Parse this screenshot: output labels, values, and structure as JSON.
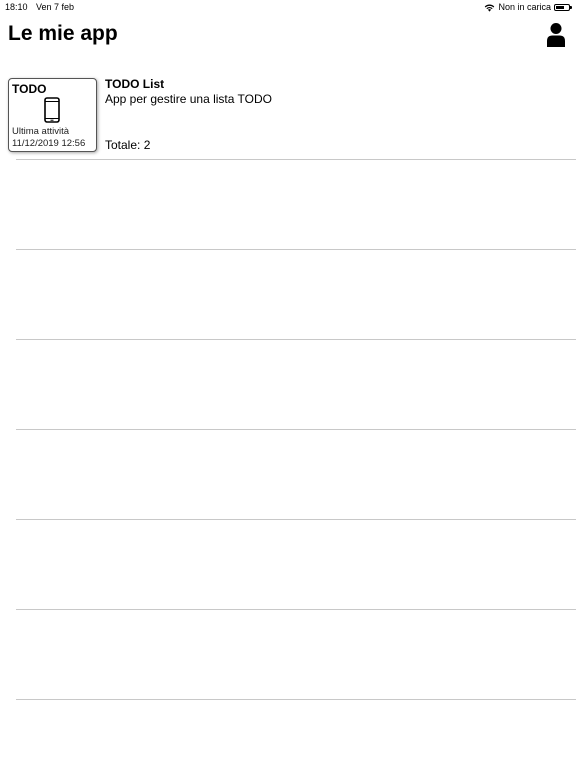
{
  "status_bar": {
    "time": "18:10",
    "date": "Ven 7 feb",
    "charging": "Non in carica",
    "wifi_icon": "wifi-icon",
    "battery_icon": "battery-icon"
  },
  "header": {
    "title": "Le mie app",
    "user_icon": "user-icon"
  },
  "apps": [
    {
      "card_code": "TODO",
      "device_icon": "smartphone-icon",
      "activity_label": "Ultima attività",
      "activity_date": "11/12/2019 12:56",
      "name": "TODO List",
      "description": "App per gestire una lista TODO",
      "total": "Totale: 2"
    }
  ]
}
